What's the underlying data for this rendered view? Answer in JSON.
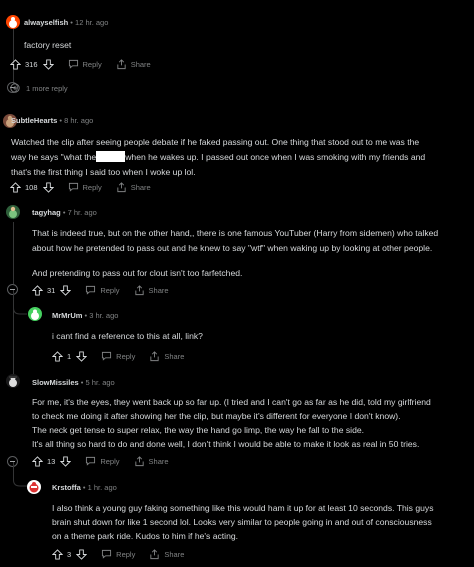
{
  "comments": [
    {
      "user": "alwayselfish",
      "time": "12 hr. ago",
      "text": [
        "factory reset"
      ],
      "votes": "316",
      "reply": "Reply",
      "share": "Share",
      "more_replies": "1 more reply"
    },
    {
      "user": "SubtleHearts",
      "time": "8 hr. ago",
      "text_a": "Watched the clip after seeing people debate if he faked passing out. One thing that stood out to me was the",
      "text_b1": "way he says \"what the",
      "text_b2": "when he wakes up. I passed out once when I was smoking with my friends and",
      "text_c": "that's the first thing I said too when I woke up lol.",
      "votes": "108",
      "reply": "Reply",
      "share": "Share"
    },
    {
      "user": "tagyhag",
      "time": "7 hr. ago",
      "text": [
        "That is indeed true, but on the other hand,, there is one famous YouTuber (Harry from sidemen) who talked",
        "about how he pretended to pass out and he knew to say \"wtf\" when waking up by looking at other people."
      ],
      "text2": "And pretending to pass out for clout isn't too farfetched.",
      "votes": "31",
      "reply": "Reply",
      "share": "Share"
    },
    {
      "user": "MrMrUm",
      "time": "3 hr. ago",
      "text": [
        "i cant find a reference to this at all, link?"
      ],
      "votes": "1",
      "reply": "Reply",
      "share": "Share"
    },
    {
      "user": "SlowMissiles",
      "time": "5 hr. ago",
      "text": [
        "For me, it's the eyes, they went back up so far up. (I tried and I can't go as far as he did, told my girlfriend",
        "to check me doing it after showing her the clip, but maybe it's different for everyone I don't know).",
        "The neck get tense to super relax, the way the hand go limp, the way he fall to the side.",
        "It's all thing so hard to do and done well, I don't think I would be able to make it look as real in 50 tries."
      ],
      "votes": "13",
      "reply": "Reply",
      "share": "Share"
    },
    {
      "user": "Krstoffa",
      "time": "1 hr. ago",
      "text": [
        "I also think a young guy faking something like this would ham it up for at least 10 seconds. This guys",
        "brain shut down for like 1 second lol. Looks very similar to people going in and out of consciousness",
        "on a theme park ride. Kudos to him if he's acting."
      ],
      "votes": "3",
      "reply": "Reply",
      "share": "Share"
    }
  ],
  "separator": "•",
  "colors": {
    "background": "#000000",
    "text": "#d7dadc",
    "muted": "#818384",
    "thread_line": "#343536"
  }
}
